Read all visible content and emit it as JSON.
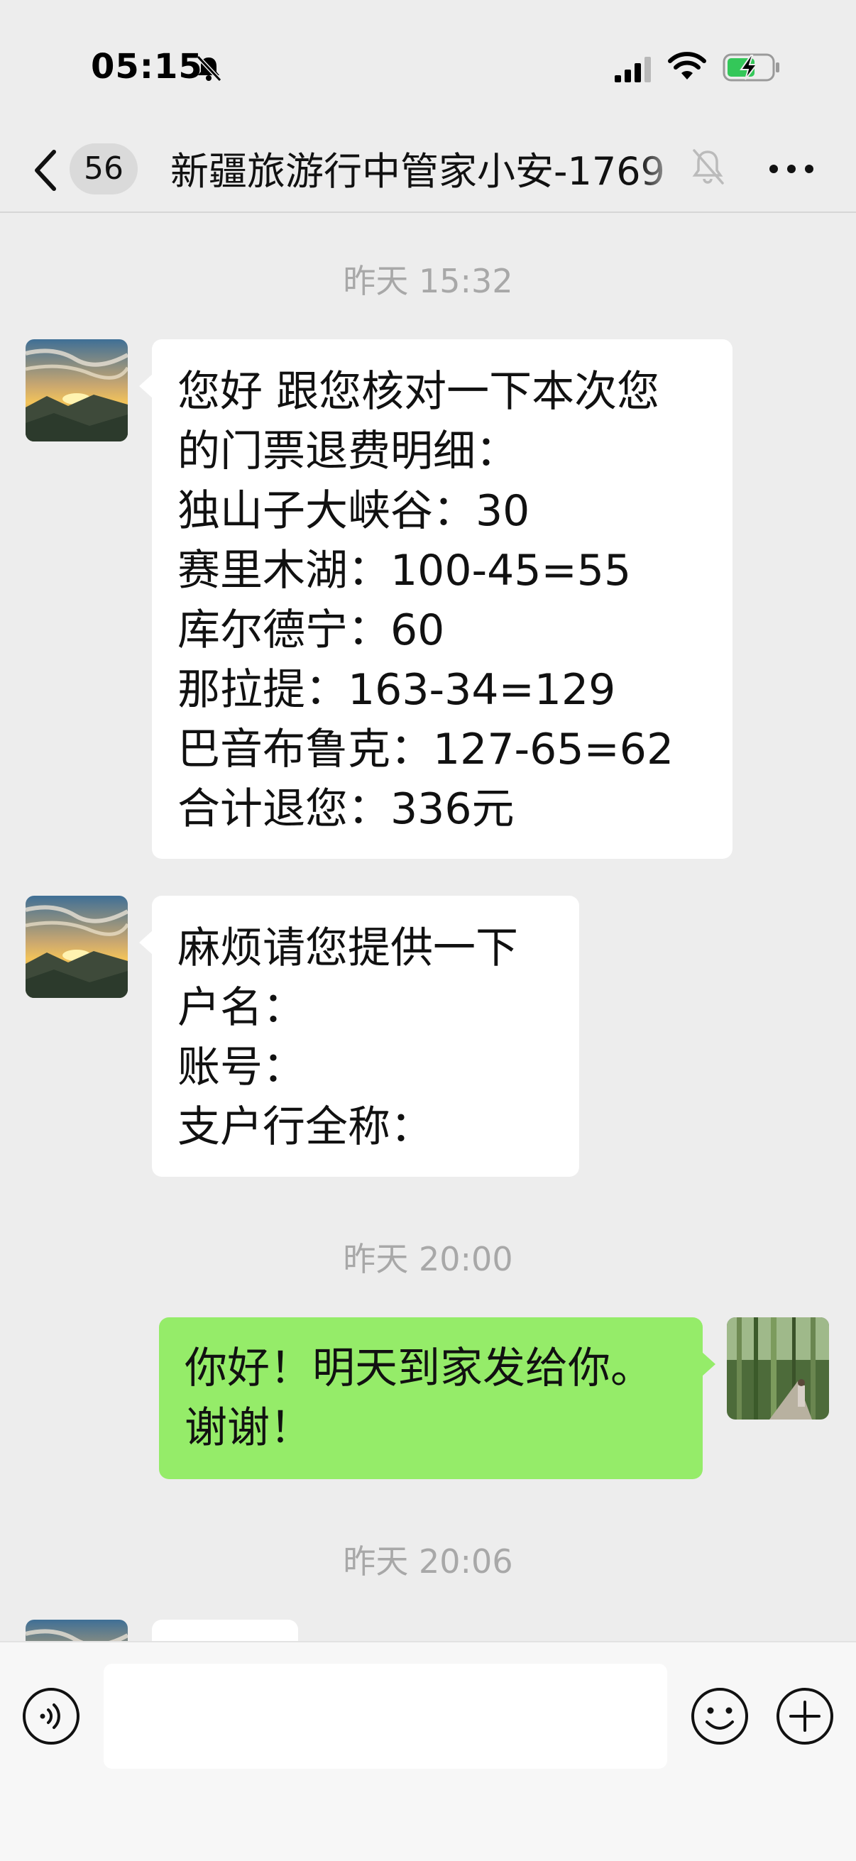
{
  "status_bar": {
    "time": "05:15"
  },
  "nav": {
    "unread_count": "56",
    "title": "新疆旅游行中管家小安-1769"
  },
  "messages": [
    {
      "timestamp": "昨天 15:32",
      "sender": "other",
      "bubbles": [
        {
          "lines": [
            "您好 跟您核对一下本次您",
            "的门票退费明细：",
            "独山子大峡谷：30",
            "赛里木湖：100-45=55",
            "库尔德宁：60",
            "那拉提：163-34=129",
            "巴音布鲁克：127-65=62",
            "合计退您：336元"
          ]
        },
        {
          "lines": [
            "麻烦请您提供一下",
            "户名：",
            "账号：",
            "支户行全称："
          ]
        }
      ]
    },
    {
      "timestamp": "昨天 20:00",
      "sender": "me",
      "bubbles": [
        {
          "lines": [
            "你好！明天到家发给你。",
            "谢谢！"
          ]
        }
      ]
    },
    {
      "timestamp": "昨天 20:06",
      "sender": "other",
      "bubbles": []
    }
  ],
  "input_bar": {
    "placeholder": ""
  },
  "icons": {
    "back": "chevron-left-icon",
    "mute": "bell-slash-icon",
    "more": "ellipsis-icon",
    "voice": "voice-icon",
    "emoji": "smiley-icon",
    "plus": "plus-icon"
  },
  "colors": {
    "background": "#ededed",
    "my_bubble": "#95ec69",
    "their_bubble": "#ffffff",
    "timestamp_text": "#a8a8a8"
  }
}
